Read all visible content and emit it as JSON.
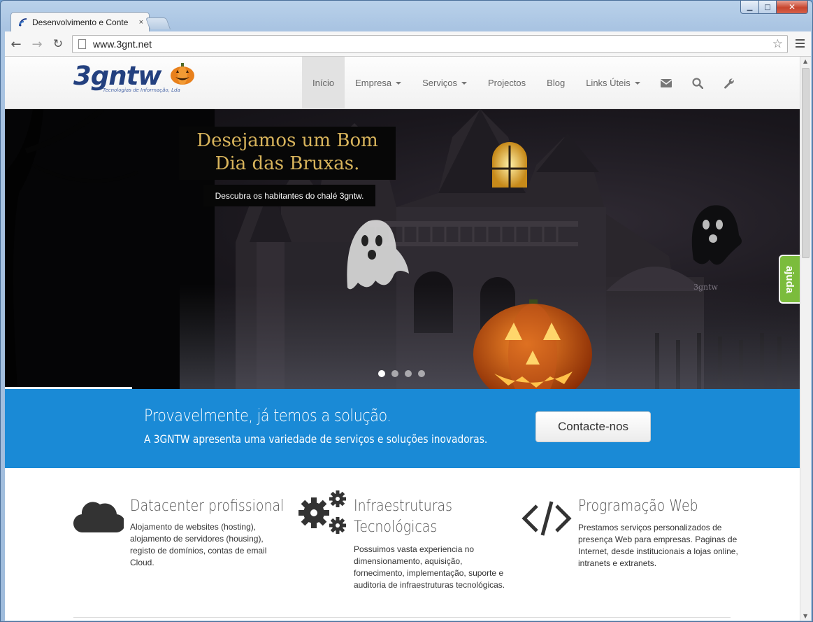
{
  "browser": {
    "tab_title": "Desenvolvimento e Conte",
    "tab_close": "×",
    "url": "www.3gnt.net",
    "window_controls": {
      "minimize": "▁",
      "maximize": "□",
      "close": "✕"
    }
  },
  "header": {
    "logo_text": "3gntw",
    "logo_tagline": "Tecnologias de Informação, Lda",
    "nav": [
      {
        "label": "Início",
        "active": true
      },
      {
        "label": "Empresa",
        "dropdown": true
      },
      {
        "label": "Serviços",
        "dropdown": true
      },
      {
        "label": "Projectos"
      },
      {
        "label": "Blog"
      },
      {
        "label": "Links Úteis",
        "dropdown": true
      }
    ],
    "nav_icons": [
      "envelope-icon",
      "search-icon",
      "wrench-icon"
    ]
  },
  "hero": {
    "title": "Desejamos um Bom Dia das Bruxas.",
    "subtitle": "Descubra os habitantes do chalé 3gntw.",
    "slide_count": 4,
    "active_slide": 1,
    "house_sign": "3gntw",
    "help_tab": "ajuda"
  },
  "cta": {
    "title": "Provavelmente, já temos a solução.",
    "subtitle": "A 3GNTW apresenta uma variedade de serviços e soluções inovadoras.",
    "button": "Contacte-nos",
    "color": "#1a8ad6"
  },
  "features": [
    {
      "icon": "cloud-icon",
      "title": "Datacenter profissional",
      "text": "Alojamento de websites (hosting), alojamento de servidores (housing), registo de domínios, contas de email Cloud."
    },
    {
      "icon": "gears-icon",
      "title": "Infraestruturas Tecnológicas",
      "text": "Possuimos vasta experiencia no dimensionamento, aquisição, fornecimento, implementação, suporte e auditoria de infraestruturas tecnológicas."
    },
    {
      "icon": "code-icon",
      "title": "Programação Web",
      "text": "Prestamos serviços personalizados de presença Web para empresas. Paginas de Internet, desde institucionais a lojas online, intranets e extranets."
    }
  ]
}
